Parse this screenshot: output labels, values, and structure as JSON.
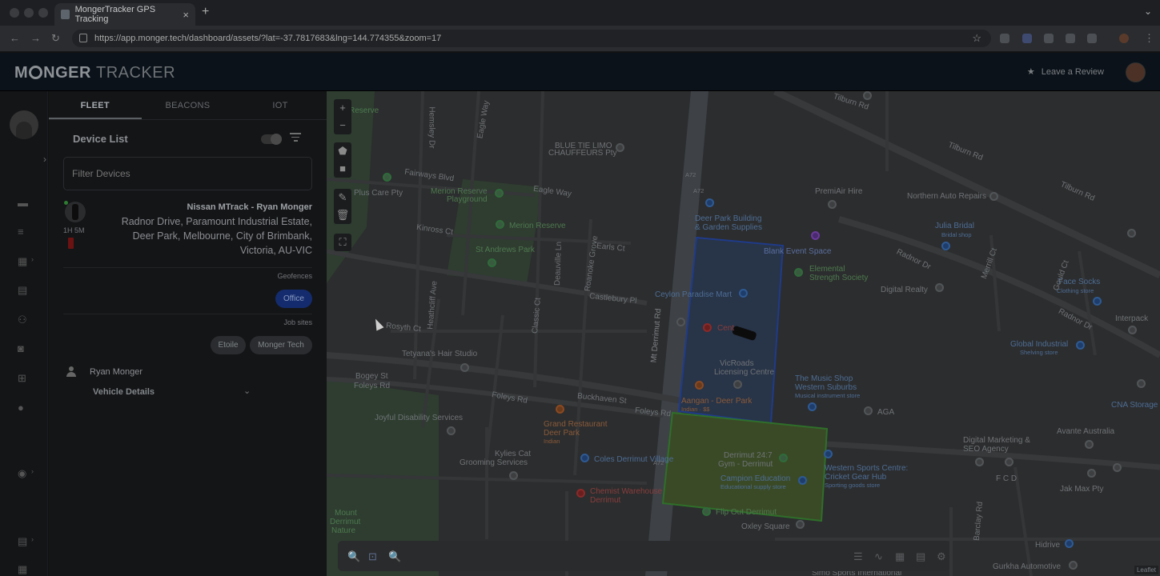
{
  "browser": {
    "tab_title": "MongerTracker GPS Tracking",
    "tab_close": "×",
    "new_tab": "+",
    "url": "https://app.monger.tech/dashboard/assets/?lat=-37.7817683&lng=144.774355&zoom=17",
    "back": "←",
    "forward": "→",
    "reload": "↻",
    "bookmark": "☆"
  },
  "app": {
    "logo_monger": "M  NGER",
    "logo_tracker": "TRACKER",
    "leave_review": "Leave a Review",
    "star_icon": "★"
  },
  "panel": {
    "tabs": [
      "FLEET",
      "BEACONS",
      "IOT"
    ],
    "device_list_title": "Device List",
    "filter_placeholder": "Filter Devices",
    "device": {
      "name": "Nissan MTrack - Ryan Monger",
      "address": "Radnor Drive, Paramount Industrial Estate, Deer Park, Melbourne, City of Brimbank, Victoria, AU-VIC",
      "age": "1H 5M"
    },
    "geofences_label": "Geofences",
    "geofences": [
      "Office"
    ],
    "job_sites_label": "Job sites",
    "job_sites": [
      "Etoile",
      "Monger Tech"
    ],
    "driver": "Ryan Monger",
    "vehicle_details": "Vehicle Details",
    "chevron": "⌄"
  },
  "map": {
    "zoom_in": "+",
    "zoom_out": "−",
    "attribution": "Leaflet",
    "labels": {
      "tilburn1": "Tilburn Rd",
      "tilburn2": "Tilburn Rd",
      "tilburn3": "Tilburn Rd",
      "reserve": "Reserve",
      "hemsley": "Hemsley Dr",
      "eagle_way_v": "Eagle Way",
      "eagle_way": "Eagle Way",
      "blue_tie": "BLUE TIE LIMO",
      "blue_tie2": "CHAUFFEURS Pty",
      "fairways": "Fairways Blvd",
      "plus_care": "Plus Care Pty",
      "merion_pg": "Merion Reserve",
      "merion_pg2": "Playground",
      "merion_res": "Merion Reserve",
      "kinross": "Kinross Ct",
      "st_andrews": "St Andrews Park",
      "deauville": "Deauville Ln",
      "roanoke": "Roanoke Grove",
      "earls": "Earls Ct",
      "castlebury": "Castlebury Pl",
      "heathcliff": "Heathcliff Ave",
      "classic": "Classic Ct",
      "rosyth": "Rosyth Ct",
      "tetyana": "Tetyana's Hair Studio",
      "bogey": "Bogey St",
      "foleys1": "Foleys Rd",
      "foleys2": "Foleys Rd",
      "foleys3": "Foleys Rd",
      "buckhaven": "Buckhaven St",
      "joyful": "Joyful Disability Services",
      "grand": "Grand Restaurant",
      "grand2": "Deer Park",
      "grand3": "Indian",
      "kylies": "Kylies Cat",
      "kylies2": "Grooming Services",
      "coles": "Coles Derrimut Village",
      "chemist": "Chemist Warehouse",
      "chemist2": "Derrimut",
      "mount": "Mount",
      "mount2": "Derrimut",
      "mount3": "Nature",
      "derrimut_rd": "Mt Derrimut Rd",
      "deer_park_bg": "Deer Park Building",
      "deer_park_bg2": "& Garden Supplies",
      "blank": "Blank Event Space",
      "ceylon": "Ceylon Paradise Mart",
      "cent": "Cent",
      "vicroads": "VicRoads",
      "vicroads2": "Licensing Centre",
      "aangan": "Aangan - Deer Park",
      "aangan2": "Indian · $$",
      "derrimut247": "Derrimut 24:7",
      "derrimut247b": "Gym - Derrimut",
      "campion": "Campion Education",
      "campion2": "Educational supply store",
      "flip_out": "Flip Out Derrimut",
      "oxley": "Oxley Square",
      "premair": "PremiAir Hire",
      "northern": "Northern Auto Repairs",
      "julia": "Julia Bridal",
      "julia2": "Bridal shop",
      "elemental": "Elemental",
      "elemental2": "Strength Society",
      "radnor1": "Radnor Dr",
      "radnor2": "Radnor Dr",
      "digital_realty": "Digital Realty",
      "face_socks": "Face Socks",
      "face_socks2": "Clothing store",
      "interpack": "Interpack",
      "global": "Global Industrial",
      "global2": "Shelving store",
      "music": "The Music Shop",
      "music2": "Western Suburbs",
      "music3": "Musical instrument store",
      "aga": "AGA",
      "cna": "CNA Storage",
      "western": "Western Sports Centre:",
      "western2": "Cricket Gear Hub",
      "western3": "Sporting goods store",
      "digital_mkt": "Digital Marketing &",
      "digital_mkt2": "SEO Agency",
      "fcd": "F C D",
      "avante": "Avante Australia",
      "jak": "Jak Max Pty",
      "gould": "Gould Ct",
      "merrill": "Merrill Ct",
      "barclay": "Barclay Rd",
      "hidrive": "Hidrive",
      "gurkha": "Gurkha Automotive",
      "simo": "Simo Sports International",
      "a72a": "A72",
      "a72b": "A72",
      "a72c": "A72"
    }
  }
}
